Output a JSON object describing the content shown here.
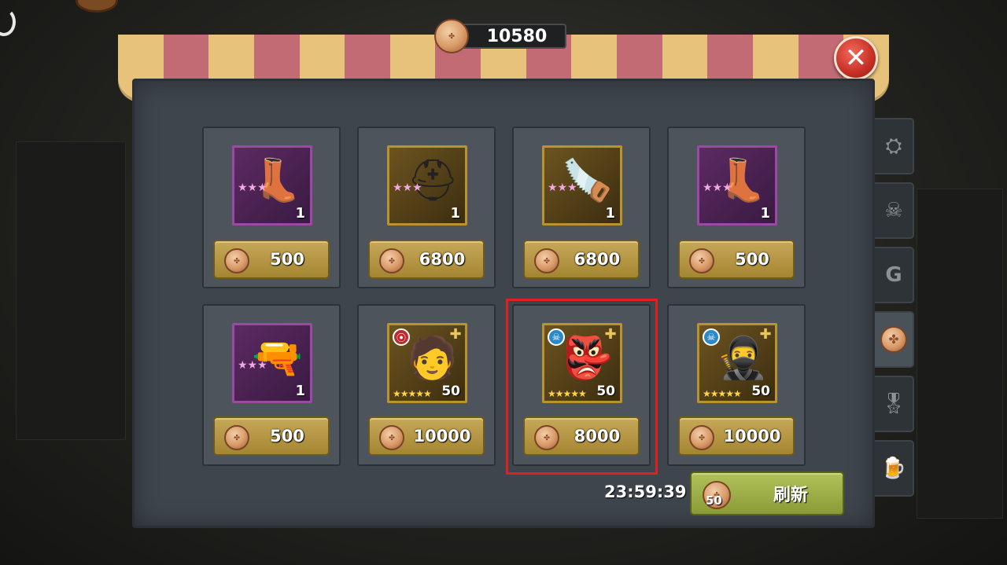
{
  "currency": {
    "balance": "10580"
  },
  "shop_items": [
    {
      "name": "Boots",
      "art": "👢",
      "stars": "★★★",
      "qty": "1",
      "price": "500",
      "rarity": "purple"
    },
    {
      "name": "Gas Mask Helmet",
      "art": "⛑",
      "stars": "★★★",
      "qty": "1",
      "price": "6800",
      "rarity": "gold"
    },
    {
      "name": "Chainsaw",
      "art": "🪚",
      "stars": "★★★",
      "qty": "1",
      "price": "6800",
      "rarity": "gold"
    },
    {
      "name": "Boots",
      "art": "👢",
      "stars": "★★★",
      "qty": "1",
      "price": "500",
      "rarity": "purple"
    },
    {
      "name": "Revolver",
      "art": "🔫",
      "stars": "★★★",
      "qty": "1",
      "price": "500",
      "rarity": "purple"
    },
    {
      "name": "Hero Shard (purple hair)",
      "art": "🧑",
      "stars": "★★★★★",
      "qty": "50",
      "price": "10000",
      "rarity": "gold",
      "badge": "red"
    },
    {
      "name": "Hero Shard (masked)",
      "art": "👺",
      "stars": "★★★★★",
      "qty": "50",
      "price": "8000",
      "rarity": "gold",
      "badge": "blue"
    },
    {
      "name": "Hero Shard (hooded)",
      "art": "🥷",
      "stars": "★★★★★",
      "qty": "50",
      "price": "10000",
      "rarity": "gold",
      "badge": "blue"
    }
  ],
  "refresh": {
    "timer": "23:59:39",
    "cost": "50",
    "label": "刷新"
  },
  "side_tabs": [
    {
      "icon": "rank-icon",
      "glyph": "⛭"
    },
    {
      "icon": "skull-badge-icon",
      "glyph": "☠"
    },
    {
      "icon": "guild-g-icon",
      "glyph": "G"
    },
    {
      "icon": "coin-shop-icon",
      "glyph": "",
      "active": true
    },
    {
      "icon": "medal-icon",
      "glyph": "🎖"
    },
    {
      "icon": "mug-icon",
      "glyph": "🍺"
    }
  ],
  "colors": {
    "highlight": "#e02020",
    "price_button": "#b89a45",
    "refresh_button": "#9aaa45"
  }
}
